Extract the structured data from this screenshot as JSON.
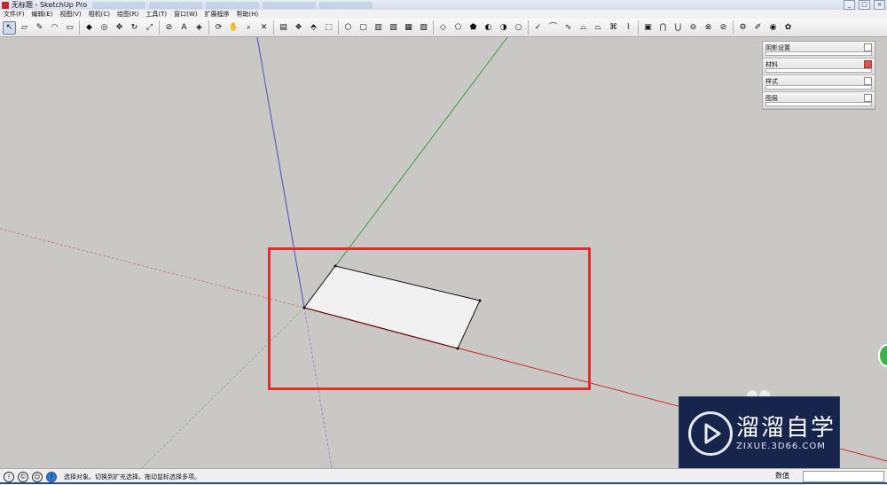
{
  "window": {
    "title": "无标题 - SketchUp Pro",
    "controls": [
      "_",
      "□",
      "×"
    ]
  },
  "menu": [
    "文件(F)",
    "编辑(E)",
    "视图(V)",
    "相机(C)",
    "绘图(R)",
    "工具(T)",
    "窗口(W)",
    "扩展程序",
    "帮助(H)"
  ],
  "toolbar": {
    "groups": [
      [
        {
          "icon": "select-icon",
          "glyph": "↖",
          "active": true
        },
        {
          "icon": "eraser-icon",
          "glyph": "▱"
        },
        {
          "icon": "pencil-icon",
          "glyph": "✎"
        },
        {
          "icon": "arc-icon",
          "glyph": "◠"
        },
        {
          "icon": "rectangle-icon",
          "glyph": "▭"
        }
      ],
      [
        {
          "icon": "push-pull-icon",
          "glyph": "◆"
        },
        {
          "icon": "offset-icon",
          "glyph": "◎"
        },
        {
          "icon": "move-icon",
          "glyph": "✥"
        },
        {
          "icon": "rotate-icon",
          "glyph": "↻"
        },
        {
          "icon": "scale-icon",
          "glyph": "⤢"
        }
      ],
      [
        {
          "icon": "tape-measure-icon",
          "glyph": "⊘"
        },
        {
          "icon": "text-icon",
          "glyph": "A"
        },
        {
          "icon": "paint-bucket-icon",
          "glyph": "◈"
        }
      ],
      [
        {
          "icon": "orbit-icon",
          "glyph": "⟳"
        },
        {
          "icon": "pan-icon",
          "glyph": "✋"
        },
        {
          "icon": "zoom-icon",
          "glyph": "⌕"
        },
        {
          "icon": "zoom-extents-icon",
          "glyph": "✕"
        }
      ],
      [
        {
          "icon": "warehouse-icon",
          "glyph": "▤"
        },
        {
          "icon": "components-icon",
          "glyph": "❖"
        },
        {
          "icon": "share-icon",
          "glyph": "⬘"
        },
        {
          "icon": "extension-icon",
          "glyph": "⬚"
        }
      ],
      [
        {
          "icon": "view-iso-icon",
          "glyph": "⬡"
        },
        {
          "icon": "view-top-icon",
          "glyph": "▢"
        },
        {
          "icon": "view-front-icon",
          "glyph": "▥"
        },
        {
          "icon": "view-right-icon",
          "glyph": "▧"
        },
        {
          "icon": "view-back-icon",
          "glyph": "▦"
        },
        {
          "icon": "view-left-icon",
          "glyph": "▨"
        }
      ],
      [
        {
          "icon": "xray-icon",
          "glyph": "◇"
        },
        {
          "icon": "wireframe-icon",
          "glyph": "⬠"
        },
        {
          "icon": "hidden-line-icon",
          "glyph": "⬟"
        },
        {
          "icon": "shaded-icon",
          "glyph": "◐"
        },
        {
          "icon": "textured-icon",
          "glyph": "◑"
        },
        {
          "icon": "monochrome-icon",
          "glyph": "○"
        }
      ],
      [
        {
          "icon": "sandbox-from-contours-icon",
          "glyph": "✓"
        },
        {
          "icon": "sandbox-from-scratch-icon",
          "glyph": "⌒"
        },
        {
          "icon": "smoove-icon",
          "glyph": "∿"
        },
        {
          "icon": "stamp-icon",
          "glyph": "⌓"
        },
        {
          "icon": "drape-icon",
          "glyph": "⏢"
        },
        {
          "icon": "add-detail-icon",
          "glyph": "⌘"
        },
        {
          "icon": "flip-edge-icon",
          "glyph": "⌇"
        }
      ],
      [
        {
          "icon": "solid-outer-shell-icon",
          "glyph": "▣"
        },
        {
          "icon": "solid-intersect-icon",
          "glyph": "⋂"
        },
        {
          "icon": "solid-union-icon",
          "glyph": "⋃"
        },
        {
          "icon": "solid-subtract-icon",
          "glyph": "⊖"
        },
        {
          "icon": "solid-trim-icon",
          "glyph": "⊗"
        },
        {
          "icon": "solid-split-icon",
          "glyph": "⊘"
        }
      ],
      [
        {
          "icon": "dynamic-components-icon",
          "glyph": "⚙"
        },
        {
          "icon": "photo-match-icon",
          "glyph": "✐"
        },
        {
          "icon": "ruby-console-icon",
          "glyph": "◉"
        },
        {
          "icon": "layout-icon",
          "glyph": "✿"
        }
      ]
    ]
  },
  "tray": {
    "items": [
      {
        "label": "阴影设置",
        "active": false
      },
      {
        "label": "材料",
        "active": true
      },
      {
        "label": "样式",
        "active": false
      },
      {
        "label": "图层",
        "active": false
      }
    ]
  },
  "statusbar": {
    "text": "选择对象。切换到扩充选择。拖动鼠标选择多项。",
    "measure_label": "数值",
    "measure_value": ""
  },
  "watermark": {
    "title": "溜溜自学",
    "subtitle": "ZIXUE.3D66.COM"
  },
  "colors": {
    "x_axis": "#c4302a",
    "y_axis": "#3f9f3f",
    "z_axis": "#4a4cc4",
    "face": "#f2f1f1",
    "highlight": "#e02d2d",
    "viewport_bg": "#cac8c4"
  }
}
